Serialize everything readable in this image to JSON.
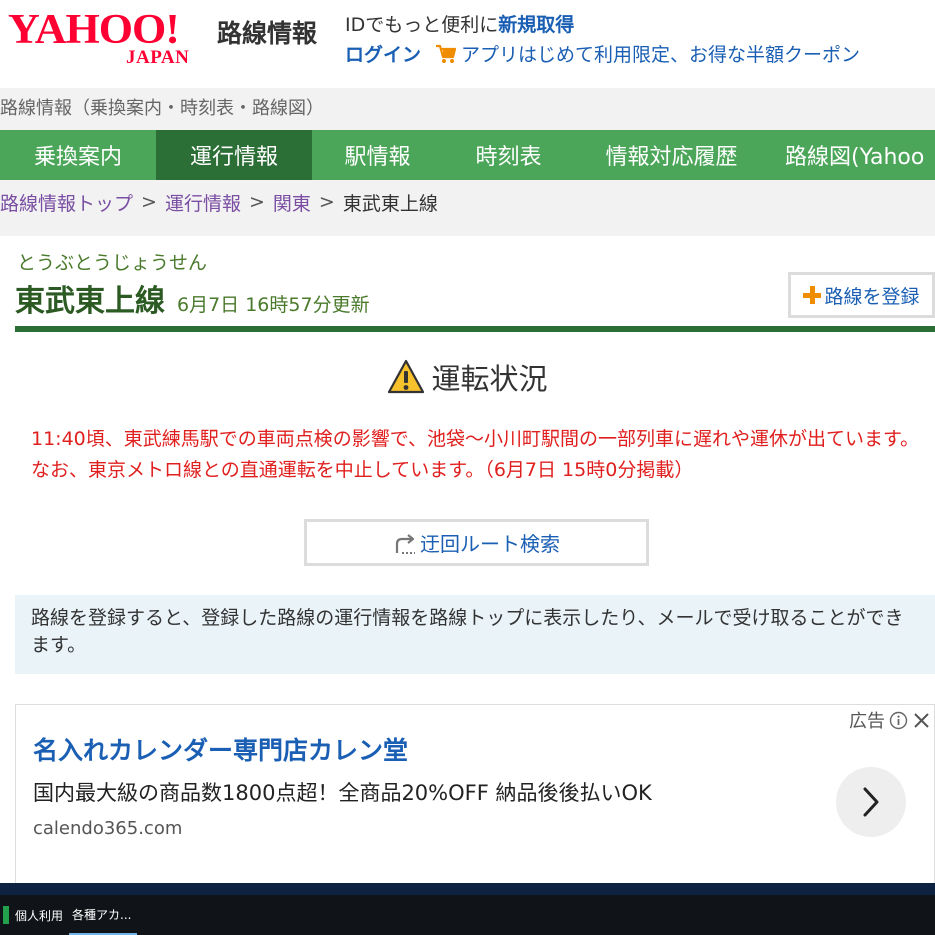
{
  "header": {
    "logo_text": "YAHOO!",
    "logo_sub": "JAPAN",
    "service_name": "路線情報",
    "promo_prefix": "IDでもっと便利に",
    "promo_strong": "新規取得",
    "login": "ログイン",
    "coupon": "アプリはじめて利用限定、お得な半額クーポン",
    "cart_icon": "cart-icon"
  },
  "subtitle": "路線情報（乗換案内・時刻表・路線図）",
  "nav": {
    "items": [
      {
        "label": "乗換案内",
        "active": false
      },
      {
        "label": "運行情報",
        "active": true
      },
      {
        "label": "駅情報",
        "active": false
      },
      {
        "label": "時刻表",
        "active": false
      },
      {
        "label": "情報対応履歴",
        "active": false
      },
      {
        "label": "路線図(Yahoo",
        "active": false
      }
    ]
  },
  "breadcrumb": {
    "items": [
      "路線情報トップ",
      "運行情報",
      "関東"
    ],
    "separator": ">",
    "current": "東武東上線"
  },
  "line": {
    "reading": "とうぶとうじょうせん",
    "name": "東武東上線",
    "updated": "6月7日 16時57分更新",
    "register_label": "路線を登録"
  },
  "status": {
    "heading": "運転状況",
    "message": "11:40頃、東武練馬駅での車両点検の影響で、池袋～小川町駅間の一部列車に遅れや運休が出ています。なお、東京メトロ線との直通運転を中止しています。（6月7日 15時0分掲載）",
    "detour_label": "迂回ルート検索"
  },
  "info_text": "路線を登録すると、登録した路線の運行情報を路線トップに表示したり、メールで受け取ることができます。",
  "ad": {
    "label": "広告",
    "headline": "名入れカレンダー専門店カレン堂",
    "description": "国内最大級の商品数1800点超！全商品20%OFF 納品後後払いOK",
    "domain": "calendo365.com"
  },
  "taskbar": {
    "items": [
      "個人利用",
      "各種アカ..."
    ]
  },
  "colors": {
    "brand_red": "#ff0033",
    "nav_green": "#4ca65a",
    "nav_active": "#2b6e36",
    "link_blue": "#1a5fb4",
    "alert_red": "#e0201f",
    "info_bg": "#e9f3f8"
  }
}
